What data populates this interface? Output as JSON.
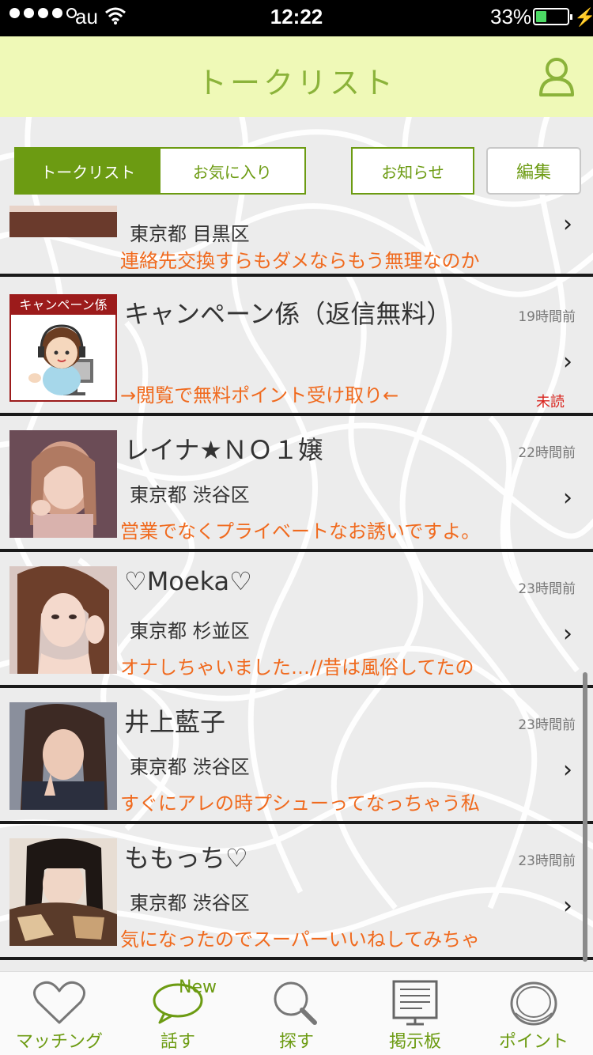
{
  "status_bar": {
    "carrier": "au",
    "time": "12:22",
    "battery": "33%"
  },
  "header": {
    "title": "トークリスト",
    "profile_icon": "person-icon"
  },
  "tabs": {
    "talk_list": "トークリスト",
    "favorites": "お気に入り",
    "notice": "お知らせ",
    "edit": "編集"
  },
  "chats": [
    {
      "name": "",
      "location": "東京都 目黒区",
      "message": "連絡先交換すらもダメならもう無理なのか",
      "time": "",
      "unread": ""
    },
    {
      "name": "キャンペーン係（返信無料）",
      "avatar_label": "キャンペーン係",
      "location": "",
      "message": "→閲覧で無料ポイント受け取り←",
      "time": "19時間前",
      "unread": "未読"
    },
    {
      "name": "レイナ★ＮＯ１嬢",
      "location": "東京都 渋谷区",
      "message": "営業でなくプライベートなお誘いですよ。",
      "time": "22時間前",
      "unread": ""
    },
    {
      "name": "♡Moeka♡",
      "location": "東京都 杉並区",
      "message": "オナしちゃいました…//昔は風俗してたの",
      "time": "23時間前",
      "unread": ""
    },
    {
      "name": "井上藍子",
      "location": "東京都 渋谷区",
      "message": "すぐにアレの時プシューってなっちゃう私",
      "time": "23時間前",
      "unread": ""
    },
    {
      "name": "ももっち♡",
      "location": "東京都 渋谷区",
      "message": "気になったのでスーパーいいねしてみちゃ",
      "time": "23時間前",
      "unread": ""
    }
  ],
  "tabbar": {
    "matching": "マッチング",
    "talk": "話す",
    "talk_badge": "New",
    "search": "探す",
    "board": "掲示板",
    "points": "ポイント"
  },
  "colors": {
    "accent": "#6c9b12",
    "header_bg": "#eff9b7",
    "message": "#f06a1e",
    "unread": "#d9231c"
  }
}
